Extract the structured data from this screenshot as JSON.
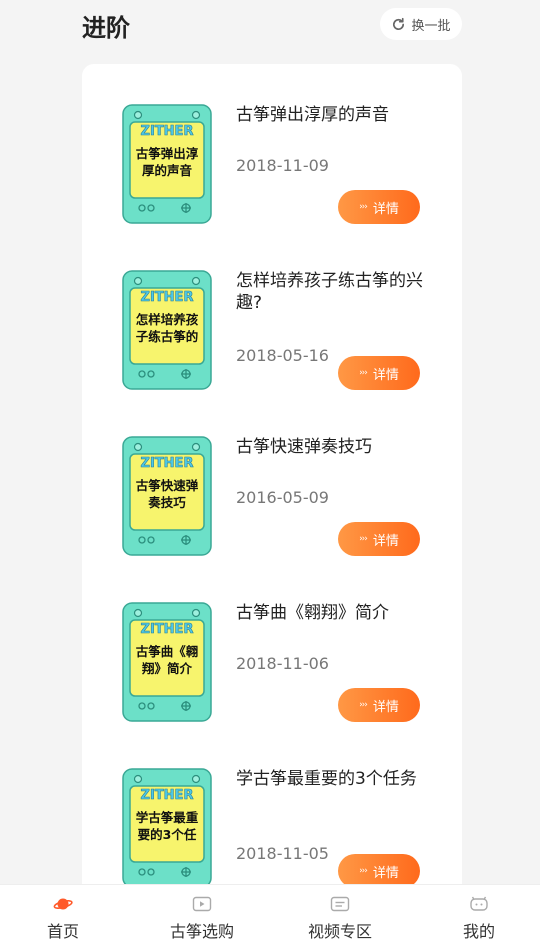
{
  "header": {
    "title": "进阶",
    "refresh_label": "换一批"
  },
  "items": [
    {
      "title": "古筝弹出淳厚的声音",
      "thumb_brand": "ZITHER",
      "thumb_text": "古筝弹出淳厚的声音",
      "date": "2018-11-09",
      "button": "详情"
    },
    {
      "title": "怎样培养孩子练古筝的兴趣?",
      "thumb_brand": "ZITHER",
      "thumb_text": "怎样培养孩子练古筝的",
      "date": "2018-05-16",
      "button": "详情"
    },
    {
      "title": "古筝快速弹奏技巧",
      "thumb_brand": "ZITHER",
      "thumb_text": "古筝快速弹奏技巧",
      "date": "2016-05-09",
      "button": "详情"
    },
    {
      "title": "古筝曲《翱翔》简介",
      "thumb_brand": "ZITHER",
      "thumb_text": "古筝曲《翱翔》简介",
      "date": "2018-11-06",
      "button": "详情"
    },
    {
      "title": "学古筝最重要的3个任务",
      "thumb_brand": "ZITHER",
      "thumb_text": "学古筝最重要的3个任",
      "date": "2018-11-05",
      "button": "详情"
    }
  ],
  "tabbar": {
    "tabs": [
      {
        "label": "首页",
        "icon": "planet-icon"
      },
      {
        "label": "古筝选购",
        "icon": "play-box-icon"
      },
      {
        "label": "视频专区",
        "icon": "message-box-icon"
      },
      {
        "label": "我的",
        "icon": "robot-face-icon"
      }
    ]
  },
  "colors": {
    "accent_orange": "#ff6a1c",
    "thumb_teal": "#6ce0c8",
    "thumb_yellow": "#f7f46d",
    "background": "#f4f4f4"
  }
}
